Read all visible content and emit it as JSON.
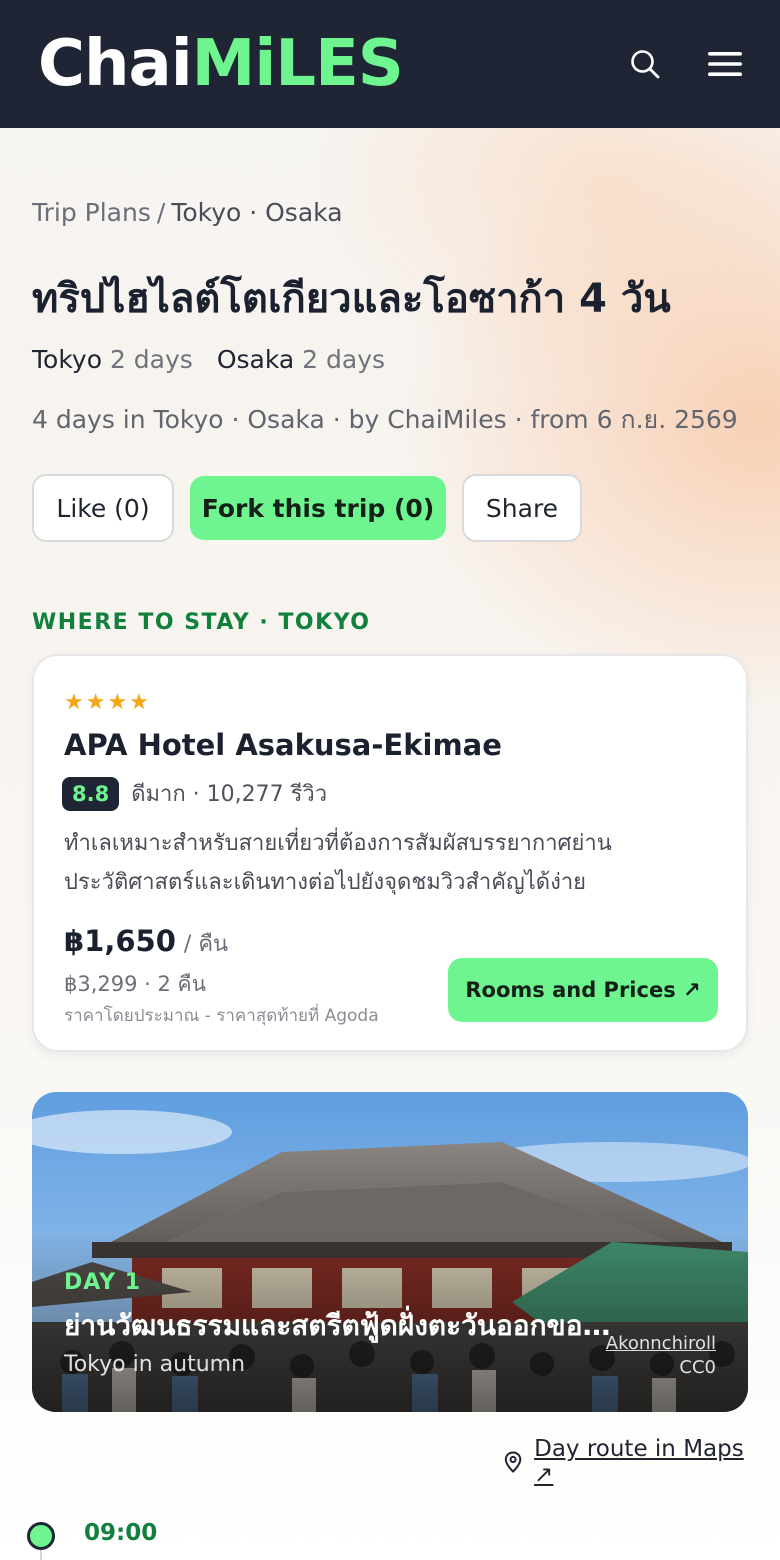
{
  "header": {
    "logo_part1": "Chai",
    "logo_part2": "MiLES",
    "search_icon": "search-icon",
    "menu_icon": "hamburger-menu-icon"
  },
  "breadcrumb": {
    "root": "Trip Plans",
    "separator": "/",
    "current": "Tokyo · Osaka"
  },
  "trip": {
    "title": "ทริปไฮไลต์โตเกียวและโอซาก้า 4 วัน",
    "cities": [
      {
        "name": "Tokyo",
        "days": "2 days"
      },
      {
        "name": "Osaka",
        "days": "2 days"
      }
    ],
    "meta": "4 days in Tokyo · Osaka · by ChaiMiles · from 6 ก.ย. 2569"
  },
  "actions": {
    "like": "Like (0)",
    "fork": "Fork this trip (0)",
    "share": "Share"
  },
  "stay": {
    "section_label": "WHERE TO STAY · TOKYO",
    "stars": "★★★★",
    "star_count": 4,
    "hotel_name": "APA Hotel Asakusa-Ekimae",
    "score": "8.8",
    "rating_text": "ดีมาก · 10,277 รีวิว",
    "description": "ทำเลเหมาะสำหรับสายเที่ยวที่ต้องการสัมผัสบรรยากาศย่านประวัติศาสตร์และเดินทางต่อไปยังจุดชมวิวสำคัญได้ง่าย",
    "price": "฿1,650",
    "price_unit": "/ คืน",
    "price_total": "฿3,299 · 2 คืน",
    "price_note": "ราคาโดยประมาณ - ราคาสุดท้ายที่ Agoda",
    "rooms_button": "Rooms and Prices ↗",
    "star_color": "#f4a619"
  },
  "day1": {
    "label": "DAY 1",
    "title": "ย่านวัฒนธรรมและสตรีตฟู้ดฝั่งตะวันออกของโตเกียว",
    "caption": "Tokyo in autumn",
    "credit_author": "Akonnchiroll",
    "credit_license": "CC0",
    "route_link": "Day route in Maps ↗",
    "route_icon": "map-pin-icon"
  },
  "timeline": {
    "first_time": "09:00"
  },
  "colors": {
    "header_bg": "#1f2535",
    "accent_green": "#6ef58f",
    "section_green": "#11803c"
  }
}
